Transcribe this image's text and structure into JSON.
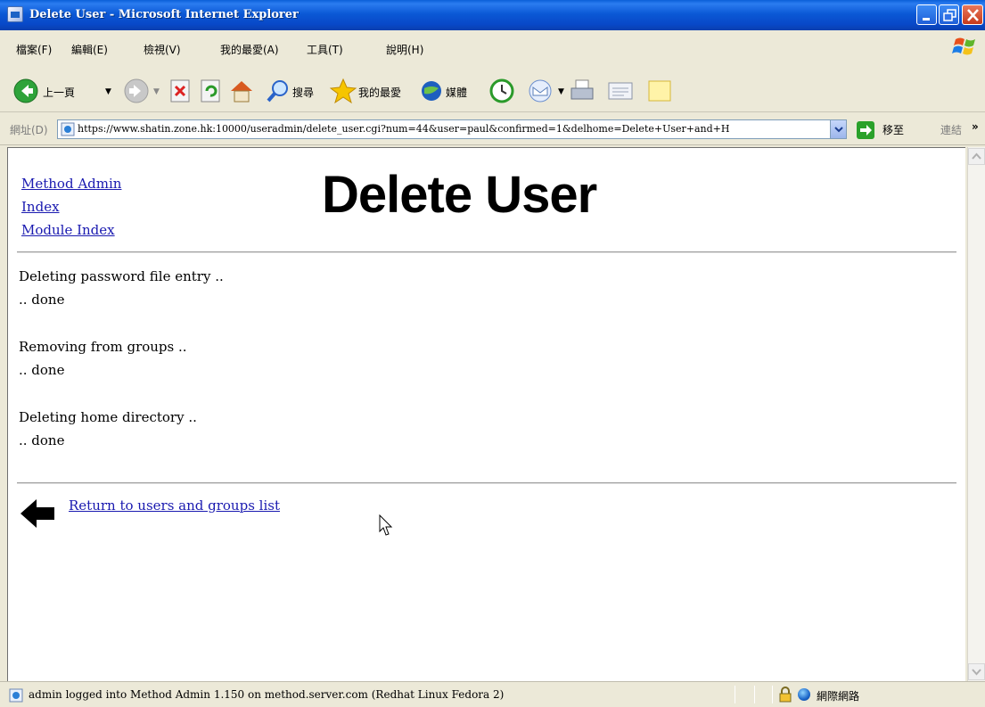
{
  "window": {
    "title": "Delete User - Microsoft Internet Explorer"
  },
  "menubar": {
    "items": [
      "檔案(F)",
      "編輯(E)",
      "檢視(V)",
      "我的最愛(A)",
      "工具(T)",
      "說明(H)"
    ]
  },
  "toolbar": {
    "back_label": "上一頁",
    "search_label": "搜尋",
    "favorites_label": "我的最愛",
    "media_label": "媒體"
  },
  "addressbar": {
    "label": "網址(D)",
    "url": "https://www.shatin.zone.hk:10000/useradmin/delete_user.cgi?num=44&user=paul&confirmed=1&delhome=Delete+User+and+H",
    "go_label": "移至",
    "links_label": "連結",
    "links_more": "»"
  },
  "page": {
    "nav_links": [
      "Method Admin",
      "Index",
      "Module Index"
    ],
    "title": "Delete User",
    "steps": [
      {
        "action": "Deleting password file entry ..",
        "result": ".. done"
      },
      {
        "action": "Removing from groups ..",
        "result": ".. done"
      },
      {
        "action": "Deleting home directory ..",
        "result": ".. done"
      }
    ],
    "return_link": "Return to users and groups list"
  },
  "statusbar": {
    "text": "admin logged into Method Admin 1.150 on method.server.com (Redhat Linux Fedora 2)",
    "zone": "網際網路"
  },
  "colors": {
    "titlebar": "#0a5fd8",
    "chrome": "#ece9d8",
    "link": "#1a1ab0",
    "content_bg": "#ffffff"
  }
}
